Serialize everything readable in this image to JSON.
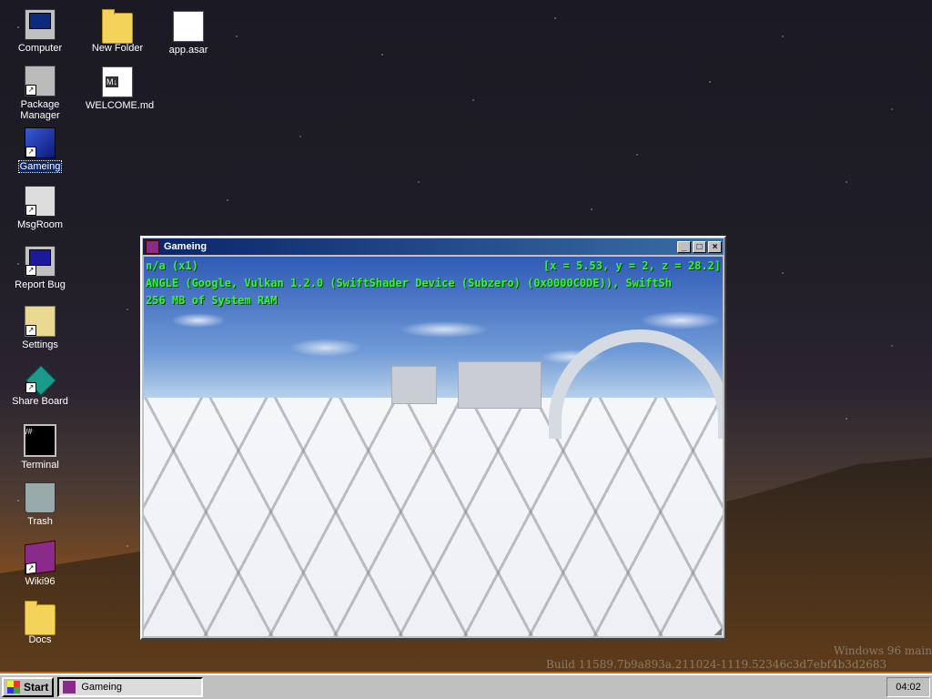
{
  "desktop": {
    "icons": [
      {
        "label": "Computer",
        "icon": "computer-icon"
      },
      {
        "label": "New Folder",
        "icon": "folder-icon"
      },
      {
        "label": "app.asar",
        "icon": "file-icon"
      },
      {
        "label": "Package Manager",
        "icon": "package-manager-icon"
      },
      {
        "label": "WELCOME.md",
        "icon": "markdown-file-icon"
      },
      {
        "label": "Gameing",
        "icon": "cube-icon"
      },
      {
        "label": "MsgRoom",
        "icon": "chat-icon"
      },
      {
        "label": "Report Bug",
        "icon": "monitor-icon"
      },
      {
        "label": "Settings",
        "icon": "settings-folder-icon"
      },
      {
        "label": "Share Board",
        "icon": "share-icon"
      },
      {
        "label": "Terminal",
        "icon": "terminal-icon"
      },
      {
        "label": "Trash",
        "icon": "trash-icon"
      },
      {
        "label": "Wiki96",
        "icon": "book-icon"
      },
      {
        "label": "Docs",
        "icon": "folder-icon"
      }
    ],
    "watermark_line1": "Windows 96 main",
    "watermark_line2": "Build 11589.7b9a893a.211024-1119.52346c3d7ebf4b3d2683"
  },
  "window": {
    "title": "Gameing",
    "minimize_label": "_",
    "maximize_label": "□",
    "close_label": "×",
    "hud": {
      "line1": "n/a (x1)",
      "coords": "[x = 5.53, y = 2, z = 28.2]",
      "line2": "ANGLE (Google, Vulkan 1.2.0 (SwiftShader Device (Subzero) (0x0000C0DE)), SwiftSh",
      "line3": "256 MB of System RAM"
    },
    "crosshair": "+"
  },
  "taskbar": {
    "start_label": "Start",
    "task_label": "Gameing",
    "clock": "04:02"
  }
}
